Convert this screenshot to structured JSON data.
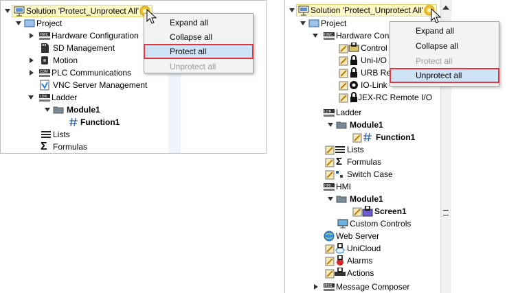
{
  "left": {
    "solution_label": "Solution 'Protect_Unprotect All'",
    "tree": [
      {
        "label": "Project",
        "bold": false
      },
      {
        "label": "Hardware Configuration",
        "bold": false
      },
      {
        "label": "SD Management",
        "bold": false
      },
      {
        "label": "Motion",
        "bold": false
      },
      {
        "label": "PLC Communications",
        "bold": false
      },
      {
        "label": "VNC Server Management",
        "bold": false
      },
      {
        "label": "Ladder",
        "bold": false
      },
      {
        "label": "Module1",
        "bold": true
      },
      {
        "label": "Function1",
        "bold": true
      },
      {
        "label": "Lists",
        "bold": false
      },
      {
        "label": "Formulas",
        "bold": false
      }
    ],
    "menu": [
      "Expand all",
      "Collapse all",
      "Protect all",
      "Unprotect all"
    ]
  },
  "right": {
    "solution_label": "Solution 'Protect_Unprotect All'",
    "tree": [
      {
        "label": "Project",
        "bold": false
      },
      {
        "label": "Hardware Con",
        "bold": false
      },
      {
        "label": "Control",
        "bold": false
      },
      {
        "label": "Uni-I/O",
        "bold": false
      },
      {
        "label": "URB Re",
        "bold": false
      },
      {
        "label": "IO-Link",
        "bold": false
      },
      {
        "label": "JEX-RC Remote I/O",
        "bold": false
      },
      {
        "label": "Ladder",
        "bold": false
      },
      {
        "label": "Module1",
        "bold": true
      },
      {
        "label": "Function1",
        "bold": true
      },
      {
        "label": "Lists",
        "bold": false
      },
      {
        "label": "Formulas",
        "bold": false
      },
      {
        "label": "Switch Case",
        "bold": false
      },
      {
        "label": "HMI",
        "bold": false
      },
      {
        "label": "Module1",
        "bold": true
      },
      {
        "label": "Screen1",
        "bold": true
      },
      {
        "label": "Custom Controls",
        "bold": false
      },
      {
        "label": "Web Server",
        "bold": false
      },
      {
        "label": "UniCloud",
        "bold": false
      },
      {
        "label": "Alarms",
        "bold": false
      },
      {
        "label": "Actions",
        "bold": false
      },
      {
        "label": "Message Composer",
        "bold": false
      }
    ],
    "menu": [
      "Expand all",
      "Collapse all",
      "Protect all",
      "Unprotect all"
    ]
  },
  "colors": {
    "highlight_border": "#e2343d",
    "highlight_fill": "#cfe3f6",
    "solution_fill": "#fff8c4"
  }
}
